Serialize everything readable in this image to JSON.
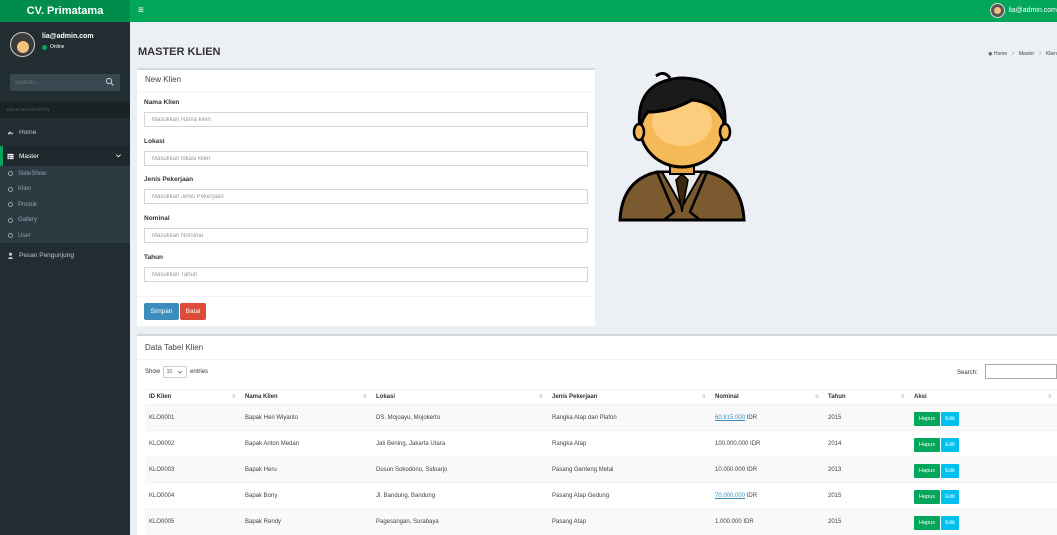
{
  "app": {
    "brand": "CV. Primatama"
  },
  "topbar": {
    "user_email": "lia@admin.com"
  },
  "sidebar": {
    "user_name": "lia@admin.com",
    "user_status": "Online",
    "search_placeholder": "Search...",
    "nav_header": "MAIN NAVIGATION",
    "home": "Home",
    "master": "Master",
    "submenu": [
      "SlideShow",
      "Klien",
      "Produk",
      "Gallery",
      "User"
    ],
    "pesan": "Pesan Pengunjung"
  },
  "content": {
    "title": "MASTER KLIEN",
    "breadcrumb": [
      "Home",
      "Master",
      "Klien"
    ]
  },
  "form": {
    "title": "New Klien",
    "fields": [
      {
        "label": "Nama Klien",
        "placeholder": "Masukkan Nama klien"
      },
      {
        "label": "Lokasi",
        "placeholder": "Masukkan lokasi klien"
      },
      {
        "label": "Jenis Pekerjaan",
        "placeholder": "Masukkan Jenis Pekerjaan"
      },
      {
        "label": "Nominal",
        "placeholder": "Masukkan Nominal"
      },
      {
        "label": "Tahun",
        "placeholder": "Masukkan Tahun"
      }
    ],
    "save_label": "Simpan",
    "cancel_label": "Batal"
  },
  "table_box": {
    "title": "Data Tabel Klien",
    "show_label": "Show",
    "entries_value": "10",
    "entries_label": "entries",
    "search_label": "Search:",
    "columns": [
      "ID Klien",
      "Nama Klien",
      "Lokasi",
      "Jenis Pekerjaan",
      "Nominal",
      "Tahun",
      "Aksi"
    ],
    "rows": [
      {
        "id": "KLO0001",
        "nama": "Bapak Heri Wiyanto",
        "lokasi": "DS. Mojoayu, Mojokerto",
        "jenis": "Rangka Atap dan Plafon",
        "nominal": "60.815.000",
        "nominal_link": true,
        "currency": "IDR",
        "tahun": "2015"
      },
      {
        "id": "KLO0002",
        "nama": "Bapak Anton Medan",
        "lokasi": "Jati Bening, Jakarta Utara",
        "jenis": "Rangka Atap",
        "nominal": "100.000.000",
        "nominal_link": false,
        "currency": "IDR",
        "tahun": "2014"
      },
      {
        "id": "KLO0003",
        "nama": "Bapak Heru",
        "lokasi": "Dusun Sokodono, Sidoarjo",
        "jenis": "Pasang Genteng Metal",
        "nominal": "10.000.000",
        "nominal_link": false,
        "currency": "IDR",
        "tahun": "2013"
      },
      {
        "id": "KLO0004",
        "nama": "Bapak Bony",
        "lokasi": "Jl. Bandung, Bandung",
        "jenis": "Pasang Atap Gedung",
        "nominal": "70.000.000",
        "nominal_link": true,
        "currency": "IDR",
        "tahun": "2015"
      },
      {
        "id": "KLO0005",
        "nama": "Bapak Rendy",
        "lokasi": "Pagesangan, Surabaya",
        "jenis": "Pasang Atap",
        "nominal": "1.000.000",
        "nominal_link": false,
        "currency": "IDR",
        "tahun": "2015"
      }
    ],
    "delete_label": "Hapus",
    "edit_label": "Edit"
  },
  "colors": {
    "brand": "#00a65a",
    "brand_dark": "#008d4c",
    "sidebar": "#222d32",
    "primary": "#3c8dbc",
    "danger": "#dd4b39",
    "info": "#00c0ef"
  }
}
